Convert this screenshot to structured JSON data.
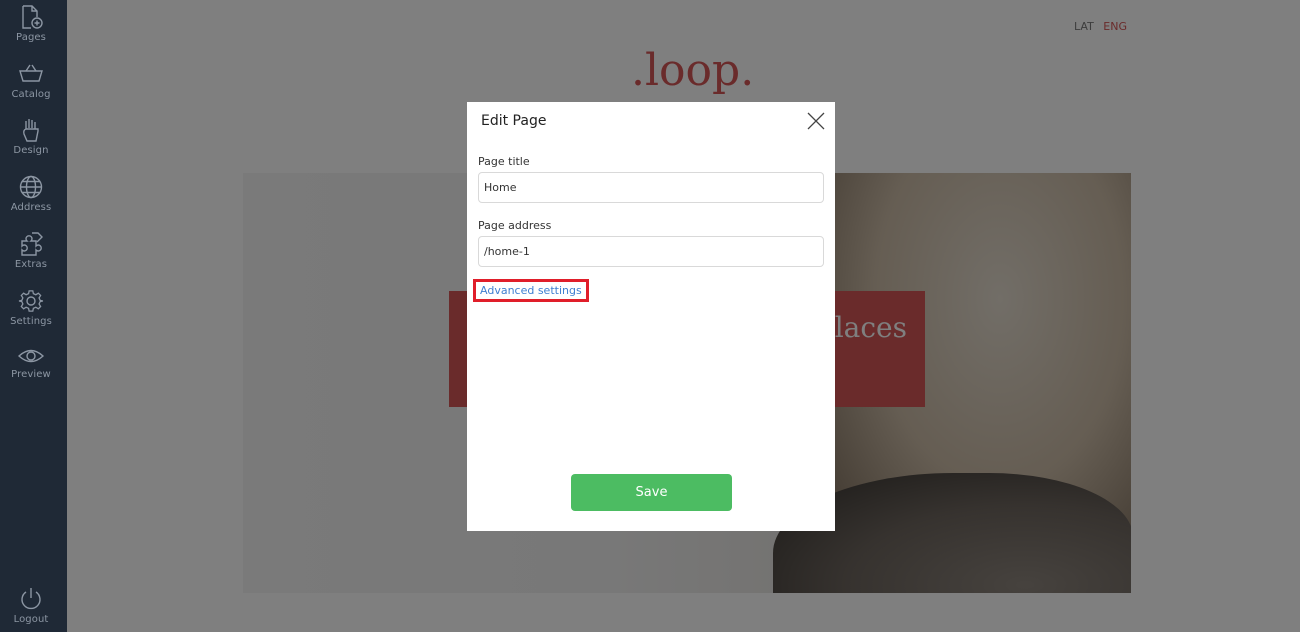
{
  "sidebar": {
    "items": [
      {
        "label": "Pages",
        "icon": "page-add-icon"
      },
      {
        "label": "Catalog",
        "icon": "basket-icon"
      },
      {
        "label": "Design",
        "icon": "hand-icon"
      },
      {
        "label": "Address",
        "icon": "globe-icon"
      },
      {
        "label": "Extras",
        "icon": "puzzle-icon"
      },
      {
        "label": "Settings",
        "icon": "gear-icon"
      },
      {
        "label": "Preview",
        "icon": "eye-icon"
      }
    ],
    "logout": {
      "label": "Logout",
      "icon": "power-icon"
    }
  },
  "site": {
    "languages": [
      "LAT",
      "ENG"
    ],
    "active_language": "ENG",
    "logo": ".loop.",
    "hero_text": "Places"
  },
  "modal": {
    "title": "Edit Page",
    "page_title_label": "Page title",
    "page_title_value": "Home",
    "page_address_label": "Page address",
    "page_address_value": "/home-1",
    "advanced_link": "Advanced settings",
    "save_label": "Save"
  },
  "colors": {
    "sidebar_bg": "#1f2936",
    "accent_red": "#d45757",
    "save_green": "#4cbc62",
    "link_blue": "#3f7fd1",
    "highlight_red": "#e01e2a"
  }
}
